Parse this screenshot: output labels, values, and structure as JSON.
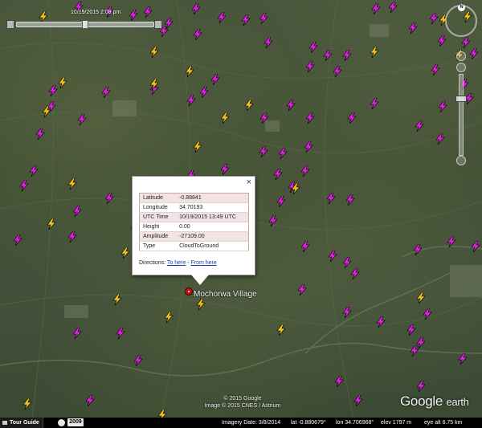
{
  "window": {
    "status_bar_bg": "#000000"
  },
  "time_slider": {
    "label": "10/19/2015  2:08 pm"
  },
  "nav": {
    "compass_label": "N"
  },
  "balloon": {
    "close_label": "×",
    "rows": [
      {
        "label": "Latitude",
        "value": "-0.88841"
      },
      {
        "label": "Longitude",
        "value": "34.70193"
      },
      {
        "label": "UTC Time",
        "value": "10/19/2015 13:49 UTC"
      },
      {
        "label": "Height",
        "value": "0.00"
      },
      {
        "label": "Amplitude",
        "value": "-27109.00"
      },
      {
        "label": "Type",
        "value": "CloudToGround"
      }
    ],
    "directions_label": "Directions:",
    "to_here": "To here",
    "separator": " - ",
    "from_here": "From here"
  },
  "placemark": {
    "name": "Mochorwa Village",
    "color": "#c1160f"
  },
  "copyright": {
    "line1": "© 2015 Google",
    "line2": "Image © 2015 CNES / Astrium"
  },
  "logo": {
    "google": "Google",
    "earth": "earth"
  },
  "status_bar": {
    "tour_guide": "Tour Guide",
    "year": "2009",
    "imagery_date": "Imagery Date: 3/8/2014",
    "lat": "lat   -0.880679°",
    "lon": "lon   34.706968°",
    "elev": "elev  1797 m",
    "eye_alt": "eye alt   6.75 km"
  },
  "strike_colors": {
    "negative": "#e020e0",
    "positive": "#f0c020"
  }
}
